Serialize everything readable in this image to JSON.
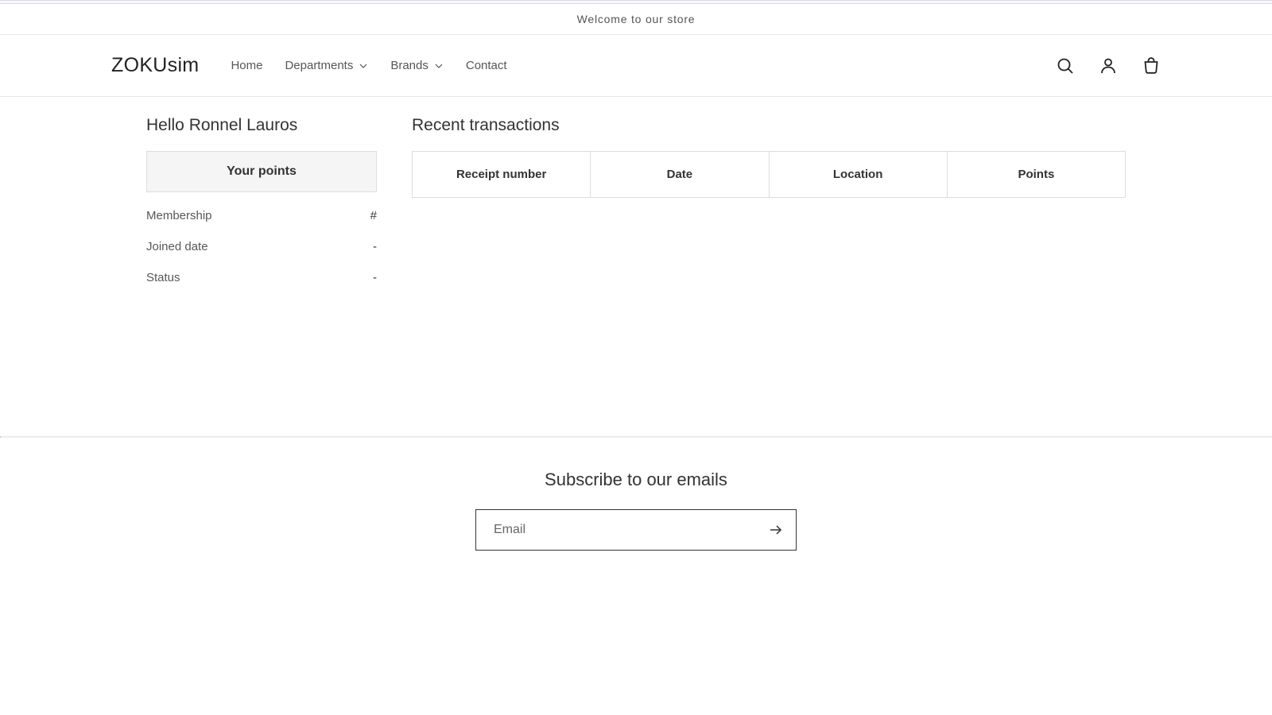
{
  "announcement": "Welcome to our store",
  "logo": "ZOKUsim",
  "nav": {
    "home": "Home",
    "departments": "Departments",
    "brands": "Brands",
    "contact": "Contact"
  },
  "sidebar": {
    "greeting": "Hello Ronnel Lauros",
    "points_label": "Your points",
    "membership_label": "Membership",
    "membership_value": "#",
    "joined_label": "Joined date",
    "joined_value": "-",
    "status_label": "Status",
    "status_value": "-"
  },
  "main": {
    "title": "Recent transactions",
    "columns": {
      "receipt": "Receipt number",
      "date": "Date",
      "location": "Location",
      "points": "Points"
    }
  },
  "footer": {
    "title": "Subscribe to our emails",
    "email_placeholder": "Email"
  }
}
